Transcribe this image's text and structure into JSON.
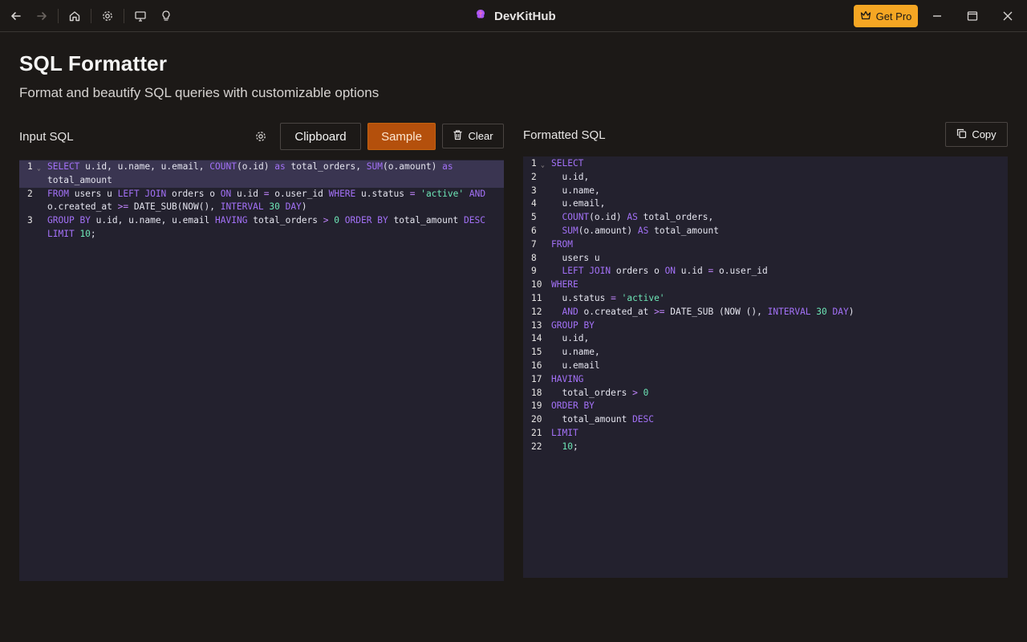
{
  "titlebar": {
    "app_name": "DevKitHub",
    "get_pro_label": "Get Pro",
    "icons": [
      "arrow-left-icon",
      "arrow-right-icon",
      "home-icon",
      "gear-icon",
      "monitor-icon",
      "lightbulb-icon"
    ]
  },
  "page": {
    "title": "SQL Formatter",
    "subtitle": "Format and beautify SQL queries with customizable options"
  },
  "input_panel": {
    "label": "Input SQL",
    "clipboard_label": "Clipboard",
    "sample_label": "Sample",
    "clear_label": "Clear",
    "lines": [
      {
        "num": "1",
        "text": "SELECT u.id, u.name, u.email, COUNT(o.id) as total_orders, SUM(o.amount) as total_amount"
      },
      {
        "num": "2",
        "text": "FROM users u LEFT JOIN orders o ON u.id = o.user_id WHERE u.status = 'active' AND o.created_at >= DATE_SUB(NOW(), INTERVAL 30 DAY)"
      },
      {
        "num": "3",
        "text": "GROUP BY u.id, u.name, u.email HAVING total_orders > 0 ORDER BY total_amount DESC LIMIT 10;"
      }
    ]
  },
  "output_panel": {
    "label": "Formatted SQL",
    "copy_label": "Copy",
    "lines": [
      {
        "num": "1",
        "text": "SELECT"
      },
      {
        "num": "2",
        "text": "  u.id,"
      },
      {
        "num": "3",
        "text": "  u.name,"
      },
      {
        "num": "4",
        "text": "  u.email,"
      },
      {
        "num": "5",
        "text": "  COUNT(o.id) AS total_orders,"
      },
      {
        "num": "6",
        "text": "  SUM(o.amount) AS total_amount"
      },
      {
        "num": "7",
        "text": "FROM"
      },
      {
        "num": "8",
        "text": "  users u"
      },
      {
        "num": "9",
        "text": "  LEFT JOIN orders o ON u.id = o.user_id"
      },
      {
        "num": "10",
        "text": "WHERE"
      },
      {
        "num": "11",
        "text": "  u.status = 'active'"
      },
      {
        "num": "12",
        "text": "  AND o.created_at >= DATE_SUB (NOW (), INTERVAL 30 DAY)"
      },
      {
        "num": "13",
        "text": "GROUP BY"
      },
      {
        "num": "14",
        "text": "  u.id,"
      },
      {
        "num": "15",
        "text": "  u.name,"
      },
      {
        "num": "16",
        "text": "  u.email"
      },
      {
        "num": "17",
        "text": "HAVING"
      },
      {
        "num": "18",
        "text": "  total_orders > 0"
      },
      {
        "num": "19",
        "text": "ORDER BY"
      },
      {
        "num": "20",
        "text": "  total_amount DESC"
      },
      {
        "num": "21",
        "text": "LIMIT"
      },
      {
        "num": "22",
        "text": "  10;"
      }
    ]
  },
  "colors": {
    "background": "#1c1917",
    "editor_bg": "#23212e",
    "accent_orange": "#b4500c",
    "pro_yellow": "#f5a623",
    "keyword": "#a371f7",
    "number_string": "#6ee7b7"
  }
}
